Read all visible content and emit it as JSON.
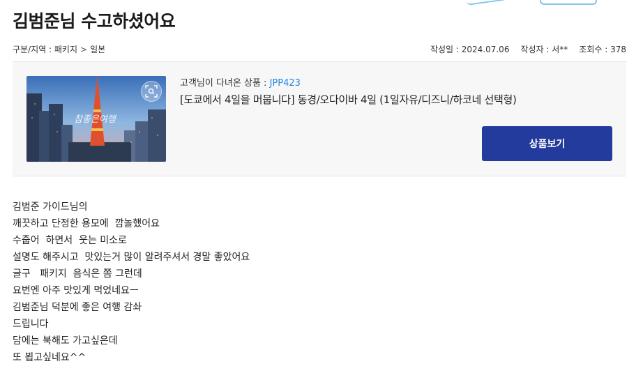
{
  "title": "김범준님 수고하셨어요",
  "breadcrumb": {
    "label": "구분/지역 : 패키지",
    "separator": ">",
    "region": "일본"
  },
  "info": {
    "date": "작성일 : 2024.07.06",
    "author": "작성자 : 서**",
    "views": "조회수 : 378"
  },
  "product": {
    "label_prefix": "고객님이 다녀온 상품 : ",
    "code": "JPP423",
    "name": "[도쿄에서 4일을 머뭅니다] 동경/오다이바 4일 (1일자유/디즈니/하코네 선택형)",
    "view_button": "상품보기",
    "thumb_watermark": "참좋은여행"
  },
  "body_lines": [
    "김범준 가이드님의",
    "깨끗하고 단정한 용모에  깜놀했어요",
    "수줍어  하면서  웃는 미소로",
    "설명도 해주시고  맛있는거 많이 알려주셔서 경말 좋았어요",
    "글구   패키지  음식은 쫌 그런데",
    "요번엔 아주 맛있게 먹었네요ㅡ",
    "김범준님 덕분에 좋은 여행 감솨",
    "드립니다",
    "담에는 북해도 가고싶은데",
    "또 뵙고싶네요^^"
  ],
  "colors": {
    "button_bg": "#233b9c",
    "code_color": "#1e88e5",
    "box_bg": "#f7f7f7"
  }
}
